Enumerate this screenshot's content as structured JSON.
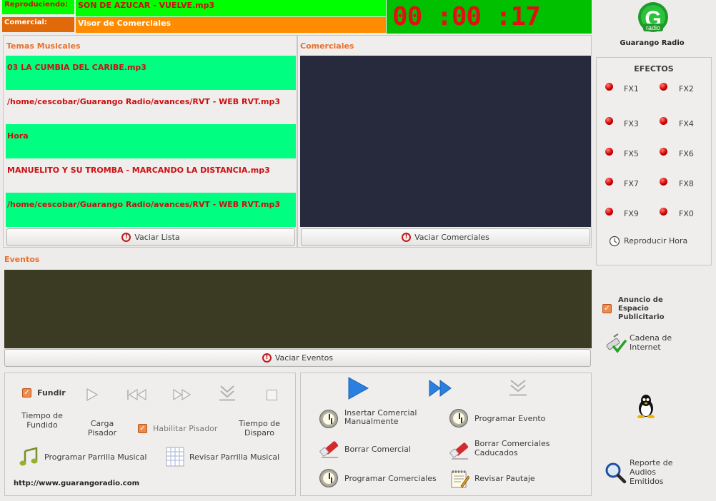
{
  "status": {
    "playing_label": "Reproduciendo:",
    "playing_value": "SON DE AZUCAR - VUELVE.mp3",
    "commercial_label": "Comercial:",
    "commercial_value": "Visor de Comerciales",
    "timer": "00 :00 :17"
  },
  "brand": {
    "logo_letter": "G",
    "logo_word": "radio",
    "name": "Guarango Radio"
  },
  "music": {
    "title": "Temas Musicales",
    "items": [
      "03 LA CUMBIA DEL CARIBE.mp3",
      "/home/cescobar/Guarango Radio/avances/RVT - WEB RVT.mp3",
      "Hora",
      "MANUELITO Y SU TROMBA - MARCANDO LA DISTANCIA.mp3",
      "/home/cescobar/Guarango Radio/avances/RVT - WEB RVT.mp3"
    ],
    "clear_label": "Vaciar Lista"
  },
  "commercials": {
    "title": "Comerciales",
    "clear_label": "Vaciar Comerciales"
  },
  "events": {
    "title": "Eventos",
    "clear_label": "Vaciar Eventos"
  },
  "effects": {
    "title": "EFECTOS",
    "items": [
      "FX1",
      "FX2",
      "FX3",
      "FX4",
      "FX5",
      "FX6",
      "FX7",
      "FX8",
      "FX9",
      "FX0"
    ],
    "play_hour": "Reproducir Hora"
  },
  "side": {
    "ad_space": "Anuncio de Espacio Publicitario",
    "internet_chain": "Cadena de Internet",
    "report": "Reporte de Audios Emitidos"
  },
  "player": {
    "fade_label": "Fundir",
    "fade_time": "Tiempo de Fundido",
    "load_stepper": "Carga Pisador",
    "enable_stepper": "Habilitar Pisador",
    "fire_time": "Tiempo de Disparo",
    "schedule_music": "Programar Parrilla Musical",
    "review_music": "Revisar Parrilla Musical",
    "website": "http://www.guarangoradio.com"
  },
  "comm_actions": {
    "insert_manual": "Insertar Comercial Manualmente",
    "schedule_event": "Programar Evento",
    "delete_commercial": "Borrar Comercial",
    "delete_expired": "Borrar Comerciales Caducados",
    "schedule_commercials": "Programar Comerciales",
    "review_schedule": "Revisar Pautaje"
  },
  "colors": {
    "green": "#00ff00",
    "orange": "#ff8c00",
    "list_green": "#00ff80",
    "commercial_panel": "#272a3d",
    "events_panel": "#3b3a22",
    "accent_title": "#e8702a"
  }
}
